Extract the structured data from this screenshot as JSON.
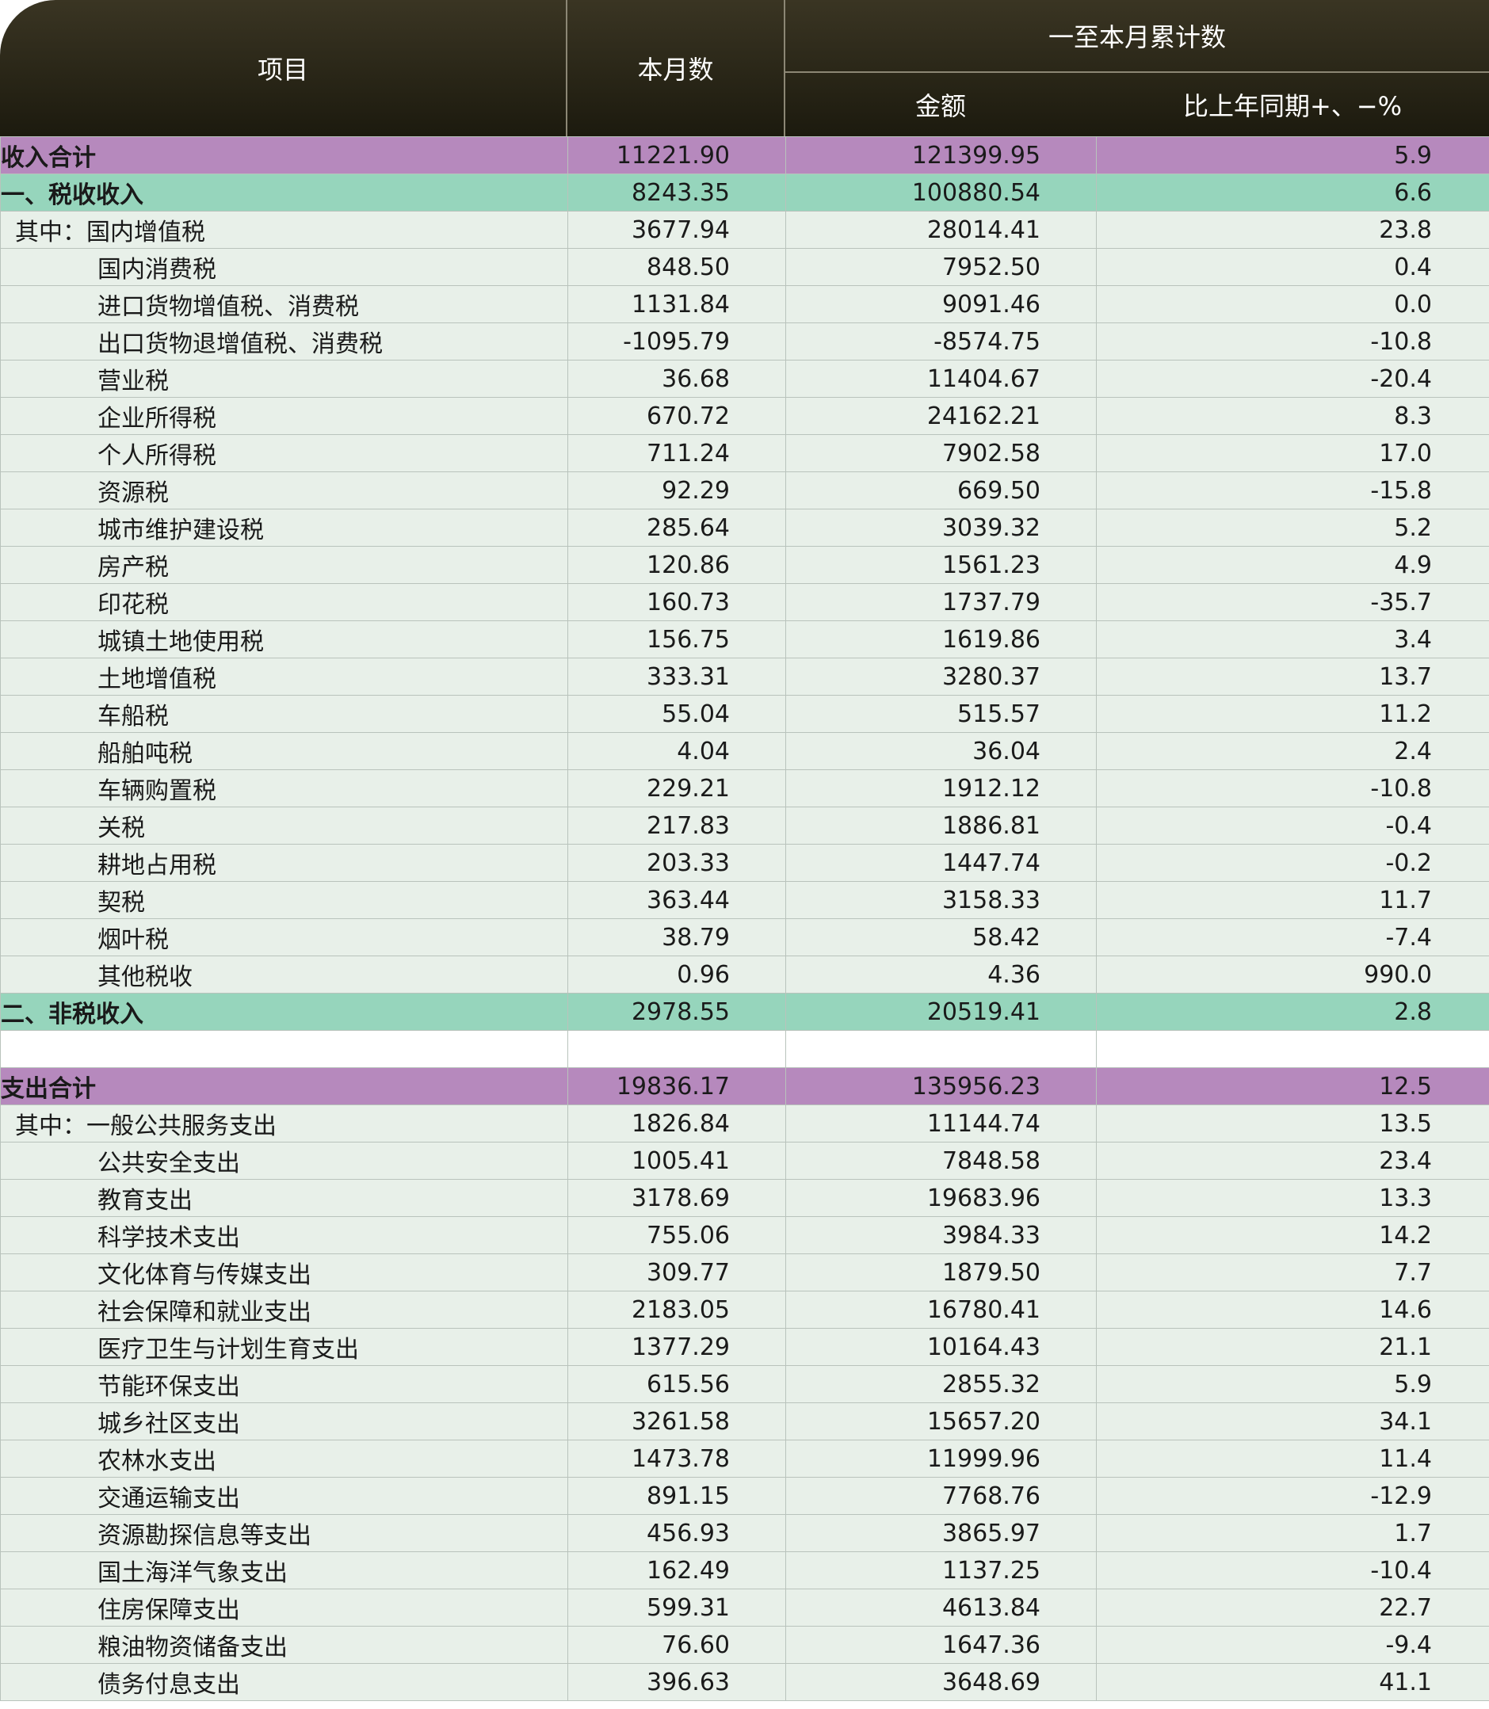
{
  "header": {
    "item": "项目",
    "month": "本月数",
    "cumulative": "一至本月累计数",
    "amount": "金额",
    "yoy": "比上年同期+、−%"
  },
  "rows": [
    {
      "type": "total",
      "name": "收入合计",
      "month": "11221.90",
      "amount": "121399.95",
      "yoy": "5.9"
    },
    {
      "type": "cat",
      "name": "一、税收收入",
      "month": "8243.35",
      "amount": "100880.54",
      "yoy": "6.6"
    },
    {
      "type": "sub1",
      "name": "其中：国内增值税",
      "month": "3677.94",
      "amount": "28014.41",
      "yoy": "23.8"
    },
    {
      "type": "sub2",
      "name": "国内消费税",
      "month": "848.50",
      "amount": "7952.50",
      "yoy": "0.4"
    },
    {
      "type": "sub2",
      "name": "进口货物增值税、消费税",
      "month": "1131.84",
      "amount": "9091.46",
      "yoy": "0.0"
    },
    {
      "type": "sub2",
      "name": "出口货物退增值税、消费税",
      "month": "-1095.79",
      "amount": "-8574.75",
      "yoy": "-10.8"
    },
    {
      "type": "sub2",
      "name": "营业税",
      "month": "36.68",
      "amount": "11404.67",
      "yoy": "-20.4"
    },
    {
      "type": "sub2",
      "name": "企业所得税",
      "month": "670.72",
      "amount": "24162.21",
      "yoy": "8.3"
    },
    {
      "type": "sub2",
      "name": "个人所得税",
      "month": "711.24",
      "amount": "7902.58",
      "yoy": "17.0"
    },
    {
      "type": "sub2",
      "name": "资源税",
      "month": "92.29",
      "amount": "669.50",
      "yoy": "-15.8"
    },
    {
      "type": "sub2",
      "name": "城市维护建设税",
      "month": "285.64",
      "amount": "3039.32",
      "yoy": "5.2"
    },
    {
      "type": "sub2",
      "name": "房产税",
      "month": "120.86",
      "amount": "1561.23",
      "yoy": "4.9"
    },
    {
      "type": "sub2",
      "name": "印花税",
      "month": "160.73",
      "amount": "1737.79",
      "yoy": "-35.7"
    },
    {
      "type": "sub2",
      "name": "城镇土地使用税",
      "month": "156.75",
      "amount": "1619.86",
      "yoy": "3.4"
    },
    {
      "type": "sub2",
      "name": "土地增值税",
      "month": "333.31",
      "amount": "3280.37",
      "yoy": "13.7"
    },
    {
      "type": "sub2",
      "name": "车船税",
      "month": "55.04",
      "amount": "515.57",
      "yoy": "11.2"
    },
    {
      "type": "sub2",
      "name": "船舶吨税",
      "month": "4.04",
      "amount": "36.04",
      "yoy": "2.4"
    },
    {
      "type": "sub2",
      "name": "车辆购置税",
      "month": "229.21",
      "amount": "1912.12",
      "yoy": "-10.8"
    },
    {
      "type": "sub2",
      "name": "关税",
      "month": "217.83",
      "amount": "1886.81",
      "yoy": "-0.4"
    },
    {
      "type": "sub2",
      "name": "耕地占用税",
      "month": "203.33",
      "amount": "1447.74",
      "yoy": "-0.2"
    },
    {
      "type": "sub2",
      "name": "契税",
      "month": "363.44",
      "amount": "3158.33",
      "yoy": "11.7"
    },
    {
      "type": "sub2",
      "name": "烟叶税",
      "month": "38.79",
      "amount": "58.42",
      "yoy": "-7.4"
    },
    {
      "type": "sub2",
      "name": "其他税收",
      "month": "0.96",
      "amount": "4.36",
      "yoy": "990.0"
    },
    {
      "type": "cat",
      "name": "二、非税收入",
      "month": "2978.55",
      "amount": "20519.41",
      "yoy": "2.8"
    },
    {
      "type": "blank",
      "name": "",
      "month": "",
      "amount": "",
      "yoy": ""
    },
    {
      "type": "total",
      "name": "支出合计",
      "month": "19836.17",
      "amount": "135956.23",
      "yoy": "12.5"
    },
    {
      "type": "sub1",
      "name": "其中：一般公共服务支出",
      "month": "1826.84",
      "amount": "11144.74",
      "yoy": "13.5"
    },
    {
      "type": "sub2",
      "name": "公共安全支出",
      "month": "1005.41",
      "amount": "7848.58",
      "yoy": "23.4"
    },
    {
      "type": "sub2",
      "name": "教育支出",
      "month": "3178.69",
      "amount": "19683.96",
      "yoy": "13.3"
    },
    {
      "type": "sub2",
      "name": "科学技术支出",
      "month": "755.06",
      "amount": "3984.33",
      "yoy": "14.2"
    },
    {
      "type": "sub2",
      "name": "文化体育与传媒支出",
      "month": "309.77",
      "amount": "1879.50",
      "yoy": "7.7"
    },
    {
      "type": "sub2",
      "name": "社会保障和就业支出",
      "month": "2183.05",
      "amount": "16780.41",
      "yoy": "14.6"
    },
    {
      "type": "sub2",
      "name": "医疗卫生与计划生育支出",
      "month": "1377.29",
      "amount": "10164.43",
      "yoy": "21.1"
    },
    {
      "type": "sub2",
      "name": "节能环保支出",
      "month": "615.56",
      "amount": "2855.32",
      "yoy": "5.9"
    },
    {
      "type": "sub2",
      "name": "城乡社区支出",
      "month": "3261.58",
      "amount": "15657.20",
      "yoy": "34.1"
    },
    {
      "type": "sub2",
      "name": "农林水支出",
      "month": "1473.78",
      "amount": "11999.96",
      "yoy": "11.4"
    },
    {
      "type": "sub2",
      "name": "交通运输支出",
      "month": "891.15",
      "amount": "7768.76",
      "yoy": "-12.9"
    },
    {
      "type": "sub2",
      "name": "资源勘探信息等支出",
      "month": "456.93",
      "amount": "3865.97",
      "yoy": "1.7"
    },
    {
      "type": "sub2",
      "name": "国土海洋气象支出",
      "month": "162.49",
      "amount": "1137.25",
      "yoy": "-10.4"
    },
    {
      "type": "sub2",
      "name": "住房保障支出",
      "month": "599.31",
      "amount": "4613.84",
      "yoy": "22.7"
    },
    {
      "type": "sub2",
      "name": "粮油物资储备支出",
      "month": "76.60",
      "amount": "1647.36",
      "yoy": "-9.4"
    },
    {
      "type": "sub2",
      "name": "债务付息支出",
      "month": "396.63",
      "amount": "3648.69",
      "yoy": "41.1"
    }
  ]
}
